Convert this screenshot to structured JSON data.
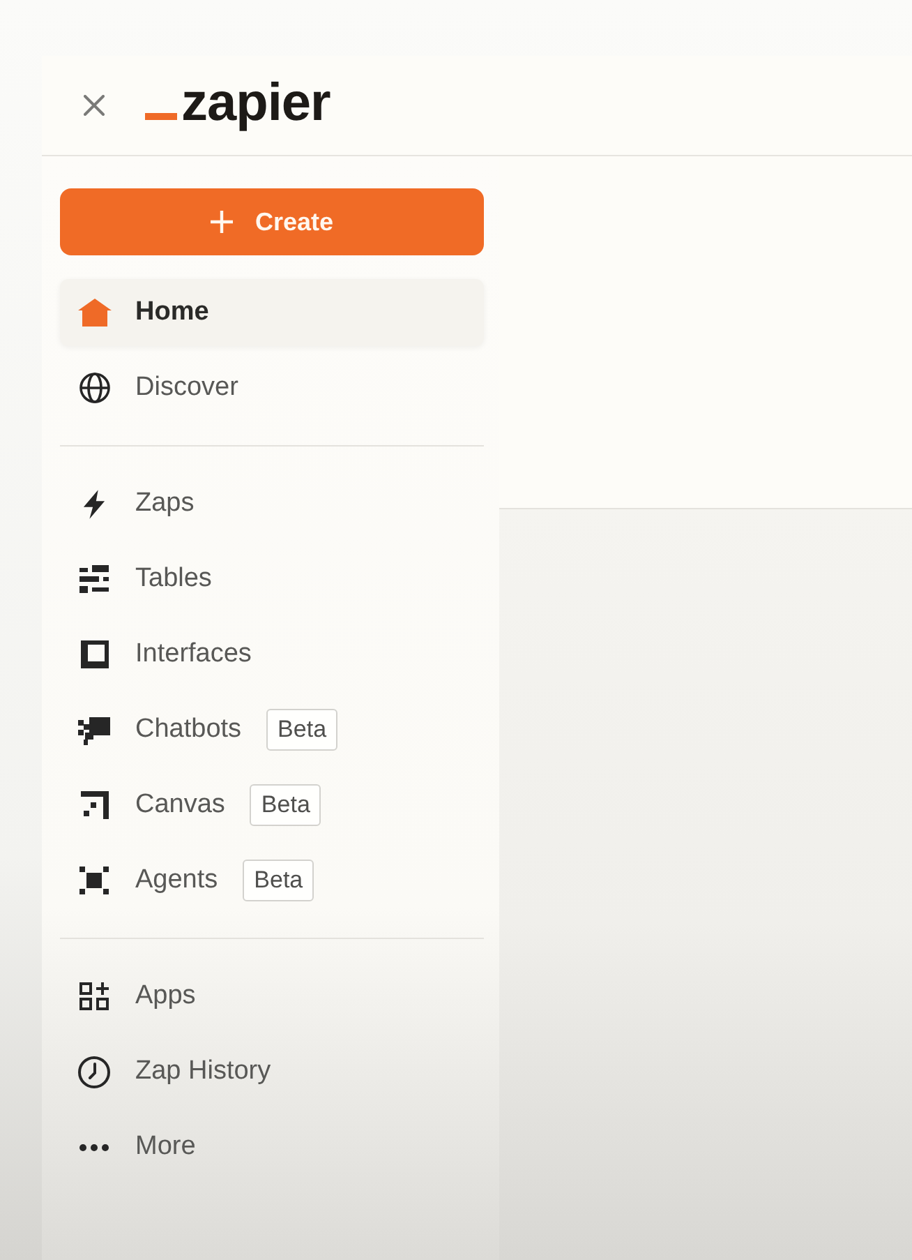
{
  "header": {
    "logo": {
      "text": "zapier"
    }
  },
  "create_button": {
    "label": "Create"
  },
  "sidebar": {
    "sections": [
      {
        "items": [
          {
            "kind": "home",
            "label": "Home",
            "selected": true
          },
          {
            "kind": "discover",
            "label": "Discover",
            "selected": false
          }
        ]
      },
      {
        "items": [
          {
            "kind": "zaps",
            "label": "Zaps",
            "selected": false
          },
          {
            "kind": "tables",
            "label": "Tables",
            "selected": false
          },
          {
            "kind": "interfaces",
            "label": "Interfaces",
            "selected": false
          },
          {
            "kind": "chatbots",
            "label": "Chatbots",
            "selected": false,
            "badge": "Beta"
          },
          {
            "kind": "canvas",
            "label": "Canvas",
            "selected": false,
            "badge": "Beta"
          },
          {
            "kind": "agents",
            "label": "Agents",
            "selected": false,
            "badge": "Beta"
          }
        ]
      },
      {
        "items": [
          {
            "kind": "apps",
            "label": "Apps",
            "selected": false
          },
          {
            "kind": "history",
            "label": "Zap History",
            "selected": false
          },
          {
            "kind": "more",
            "label": "More",
            "selected": false
          }
        ]
      }
    ]
  }
}
